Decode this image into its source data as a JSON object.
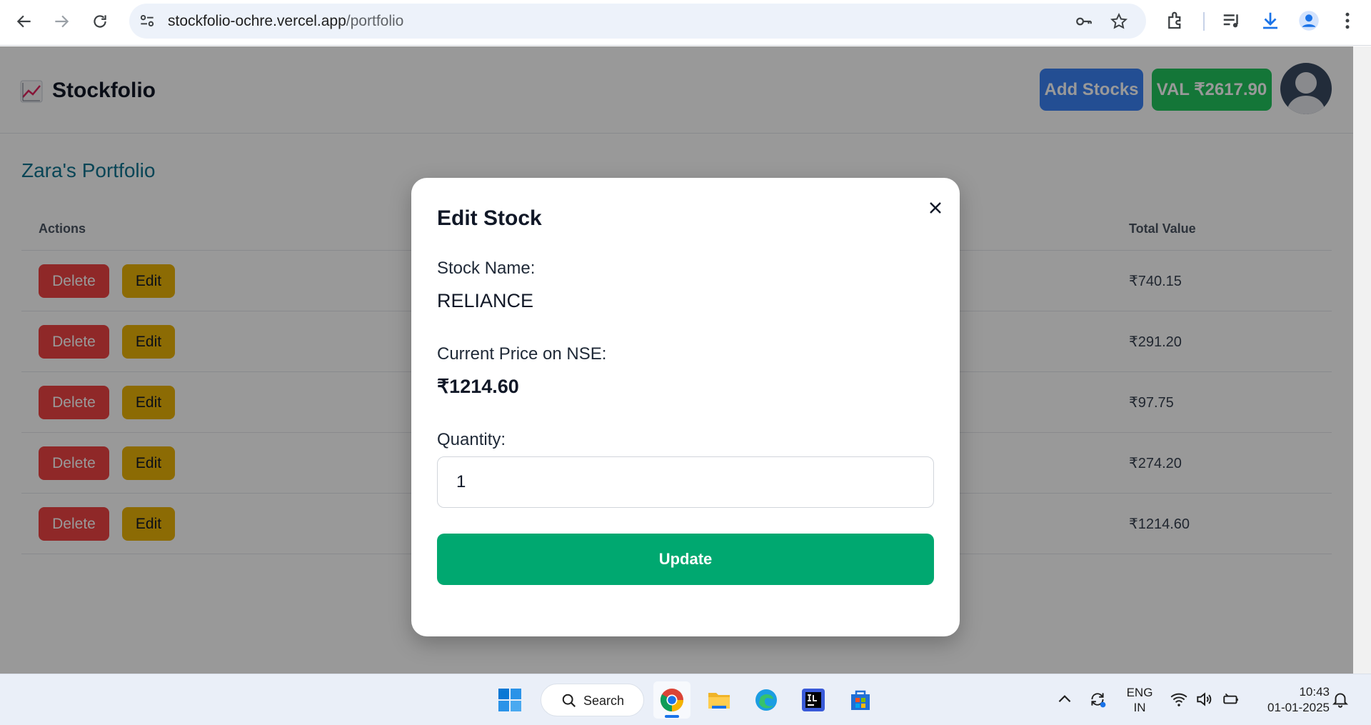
{
  "browser": {
    "url_host": "stockfolio-ochre.vercel.app",
    "url_path": "/portfolio",
    "icons": [
      "back-icon",
      "forward-icon",
      "reload-icon",
      "site-info-icon",
      "password-key-icon",
      "bookmark-star-icon",
      "extensions-icon",
      "media-control-icon",
      "download-icon",
      "profile-icon",
      "menu-dots-icon"
    ]
  },
  "app": {
    "logo_text": "Stockfolio",
    "add_stocks_label": "Add Stocks",
    "value_label": "VAL ₹2617.90",
    "portfolio_title": "Zara's Portfolio",
    "table": {
      "headers": {
        "actions": "Actions",
        "total_value": "Total Value"
      },
      "delete_label": "Delete",
      "edit_label": "Edit",
      "rows": [
        {
          "total": "₹740.15"
        },
        {
          "total": "₹291.20"
        },
        {
          "total": "₹97.75"
        },
        {
          "total": "₹274.20"
        },
        {
          "total": "₹1214.60"
        }
      ]
    }
  },
  "modal": {
    "title": "Edit Stock",
    "stock_name_label": "Stock Name:",
    "stock_name_value": "RELIANCE",
    "price_label": "Current Price on NSE:",
    "price_value": "₹1214.60",
    "quantity_label": "Quantity:",
    "quantity_value": "1",
    "update_label": "Update"
  },
  "taskbar": {
    "search_label": "Search",
    "lang_line1": "ENG",
    "lang_line2": "IN",
    "time": "10:43",
    "date": "01-01-2025"
  },
  "colors": {
    "add_stocks": "#3b82f6",
    "value_badge": "#22c55e",
    "delete": "#ef4444",
    "edit": "#eab308",
    "update": "#00a870",
    "portfolio_title": "#0e7490"
  }
}
